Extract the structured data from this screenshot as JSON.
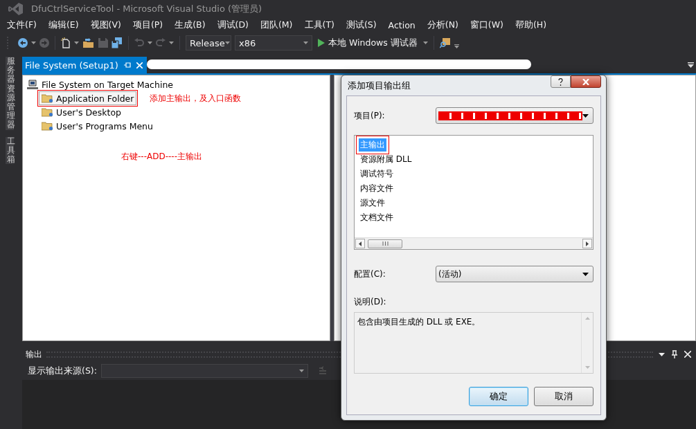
{
  "window": {
    "title": "DfuCtrlServiceTool - Microsoft Visual Studio (管理员)"
  },
  "menu": [
    "文件(F)",
    "编辑(E)",
    "视图(V)",
    "项目(P)",
    "生成(B)",
    "调试(D)",
    "团队(M)",
    "工具(T)",
    "测试(S)",
    "Action",
    "分析(N)",
    "窗口(W)",
    "帮助(H)"
  ],
  "toolbar": {
    "configuration": "Release",
    "platform": "x86",
    "start_button": "本地 Windows 调试器"
  },
  "side_tabs": [
    "服务器资源管理器",
    "工具箱"
  ],
  "document_tabs": [
    {
      "label": "File System (Setup1)",
      "selected": true
    }
  ],
  "file_system_tree": {
    "root": "File System on Target Machine",
    "children": [
      {
        "label": "Application Folder",
        "selected": true,
        "highlighted": true,
        "note": "添加主输出，及入口函数"
      },
      {
        "label": "User's Desktop",
        "selected": false,
        "highlighted": false
      },
      {
        "label": "User's Programs Menu",
        "selected": false,
        "highlighted": false
      }
    ]
  },
  "tree_note": "右键---ADD----主输出",
  "output_pane": {
    "title": "输出",
    "source_label": "显示输出来源(S):"
  },
  "dialog": {
    "title": "添加项目输出组",
    "project_label": "项目(P):",
    "output_groups": [
      {
        "label": "主输出",
        "selected": true,
        "highlighted": true
      },
      {
        "label": "资源附属 DLL",
        "selected": false,
        "highlighted": false
      },
      {
        "label": "调试符号",
        "selected": false,
        "highlighted": false
      },
      {
        "label": "内容文件",
        "selected": false,
        "highlighted": false
      },
      {
        "label": "源文件",
        "selected": false,
        "highlighted": false
      },
      {
        "label": "文档文件",
        "selected": false,
        "highlighted": false
      }
    ],
    "configuration_label": "配置(C):",
    "configuration": "(活动)",
    "description_label": "说明(D):",
    "description": "包含由项目生成的 DLL 或 EXE。",
    "buttons": [
      {
        "label": "确定",
        "default": true
      },
      {
        "label": "取消",
        "default": false
      }
    ]
  }
}
